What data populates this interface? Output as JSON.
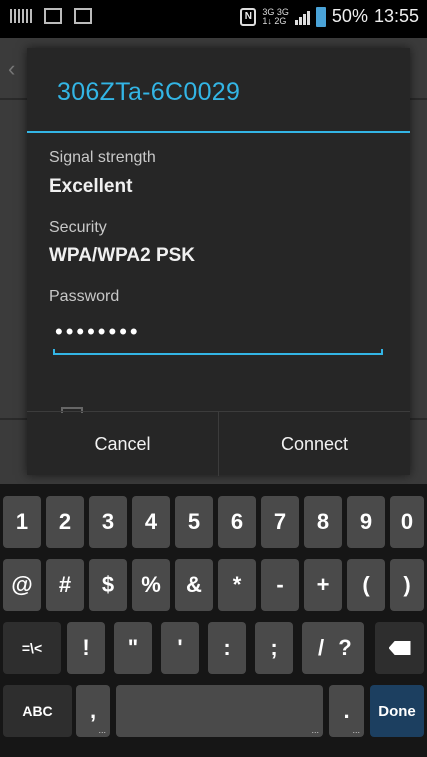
{
  "status_bar": {
    "net_top": "3G 3G",
    "net_bottom": "1↓ 2G",
    "battery_percent": "50%",
    "time": "13:55"
  },
  "dialog": {
    "title": "306ZTa-6C0029",
    "signal_label": "Signal strength",
    "signal_value": "Excellent",
    "security_label": "Security",
    "security_value": "WPA/WPA2 PSK",
    "password_label": "Password",
    "password_dots": "••••••••",
    "cancel_label": "Cancel",
    "connect_label": "Connect"
  },
  "keyboard": {
    "row1": [
      "1",
      "2",
      "3",
      "4",
      "5",
      "6",
      "7",
      "8",
      "9",
      "0"
    ],
    "row2": [
      "@",
      "#",
      "$",
      "%",
      "&",
      "*",
      "-",
      "+",
      "(",
      ")"
    ],
    "row3": [
      "=\\<",
      "!",
      "\"",
      "'",
      ":",
      ";",
      "/",
      "?"
    ],
    "abc_label": "ABC",
    "comma_label": ",",
    "period_label": ".",
    "done_label": "Done",
    "sub_dots": "..."
  },
  "colors": {
    "accent": "#33b5e5",
    "dialog_bg": "#262626",
    "key_bg": "#4a4a4a",
    "done_bg": "#1c3f60"
  }
}
